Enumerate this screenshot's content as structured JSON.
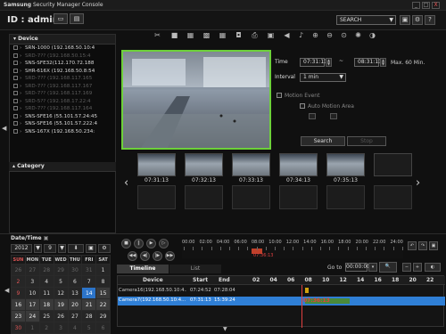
{
  "titlebar": {
    "brand": "Samsung",
    "title": "Security Manager Console",
    "buttons": [
      "_",
      "□",
      "X"
    ]
  },
  "header": {
    "id_label": "ID : admin",
    "search_value": "SEARCH"
  },
  "toolbar_icons": [
    "grid-1-icon",
    "grid-4-icon",
    "grid-9-icon",
    "grid-16-icon",
    "fullscreen-icon",
    "capture-icon",
    "print-icon",
    "record-icon",
    "audio-icon",
    "mic-icon",
    "zoom-in-icon",
    "zoom-out-icon",
    "zoom-fit-icon",
    "brightness-icon",
    "contrast-icon"
  ],
  "device_panel": {
    "title": "Device",
    "devices": [
      {
        "label": "SRN-1000 (192.168.50.10:4",
        "active": true
      },
      {
        "label": "SRD-7?? (192.168.50.15:4",
        "active": false
      },
      {
        "label": "SNS-SFE32(112.170.72.188",
        "active": true
      },
      {
        "label": "SHR-616X (192.168.50.8:54",
        "active": true
      },
      {
        "label": "SRD-7?? (192.168.117.165",
        "active": false
      },
      {
        "label": "SRD-7?? (192.168.117.167",
        "active": false
      },
      {
        "label": "SRD-7?? (192.168.117.169",
        "active": false
      },
      {
        "label": "SRD-5?? (192.168.17.22:4",
        "active": false
      },
      {
        "label": "SRD-7?? (192.168.117.164",
        "active": false
      },
      {
        "label": "SNS-SFE16 (55.101.57.24:45",
        "active": true
      },
      {
        "label": "SNS-SFE16 (55.101.57.222:4",
        "active": true
      },
      {
        "label": "SNS-167X (192.168.50.234:",
        "active": true
      }
    ]
  },
  "category_panel": {
    "title": "Category"
  },
  "search_form": {
    "time_label": "Time",
    "time_from": "07:31:13",
    "time_to": "08:31:13",
    "max_note": "Max. 60 Min.",
    "interval_label": "Interval",
    "interval_value": "1 min",
    "option1": "Motion Event",
    "option2": "Auto Motion Area",
    "search_button": "Search",
    "stop_button": "Stop"
  },
  "thumbnails": [
    "07:31:13",
    "07:32:13",
    "07:33:13",
    "07:34:13",
    "07:35:13",
    ""
  ],
  "datetime": {
    "title": "Date/Time",
    "year": "2012",
    "month": "9"
  },
  "calendar": {
    "weekdays": [
      "SUN",
      "MON",
      "TUE",
      "WED",
      "THU",
      "FRI",
      "SAT"
    ],
    "weeks": [
      [
        "26",
        "27",
        "28",
        "29",
        "30",
        "31",
        "1"
      ],
      [
        "2",
        "3",
        "4",
        "5",
        "6",
        "7",
        "8"
      ],
      [
        "9",
        "10",
        "11",
        "12",
        "13",
        "14",
        "15"
      ],
      [
        "16",
        "17",
        "18",
        "19",
        "20",
        "21",
        "22"
      ],
      [
        "23",
        "24",
        "25",
        "26",
        "27",
        "28",
        "29"
      ],
      [
        "30",
        "1",
        "2",
        "3",
        "4",
        "5",
        "6"
      ]
    ]
  },
  "timeline_ruler": {
    "hours": [
      "00:00",
      "02:00",
      "04:00",
      "06:00",
      "08:00",
      "10:00",
      "12:00",
      "14:00",
      "16:00",
      "18:00",
      "20:00",
      "22:00",
      "24:00"
    ],
    "marker_time": "07:36:13"
  },
  "tabs": [
    "Timeline",
    "List"
  ],
  "goto": {
    "label": "Go to",
    "value": "00:00:00"
  },
  "timeline": {
    "headers": {
      "device": "Device",
      "start": "Start",
      "end": "End"
    },
    "hours": [
      "02",
      "04",
      "06",
      "08",
      "10",
      "12",
      "14",
      "16",
      "18",
      "20",
      "22"
    ],
    "rows": [
      {
        "device": "Camera16(192.168.50.10:4...",
        "start": "07:24:52",
        "end": "07:28:04"
      },
      {
        "device": "Camera7(192.168.50.10:4...",
        "start": "07:31:13",
        "end": "15:39:24"
      }
    ],
    "cursor_time": "07:36:13"
  }
}
